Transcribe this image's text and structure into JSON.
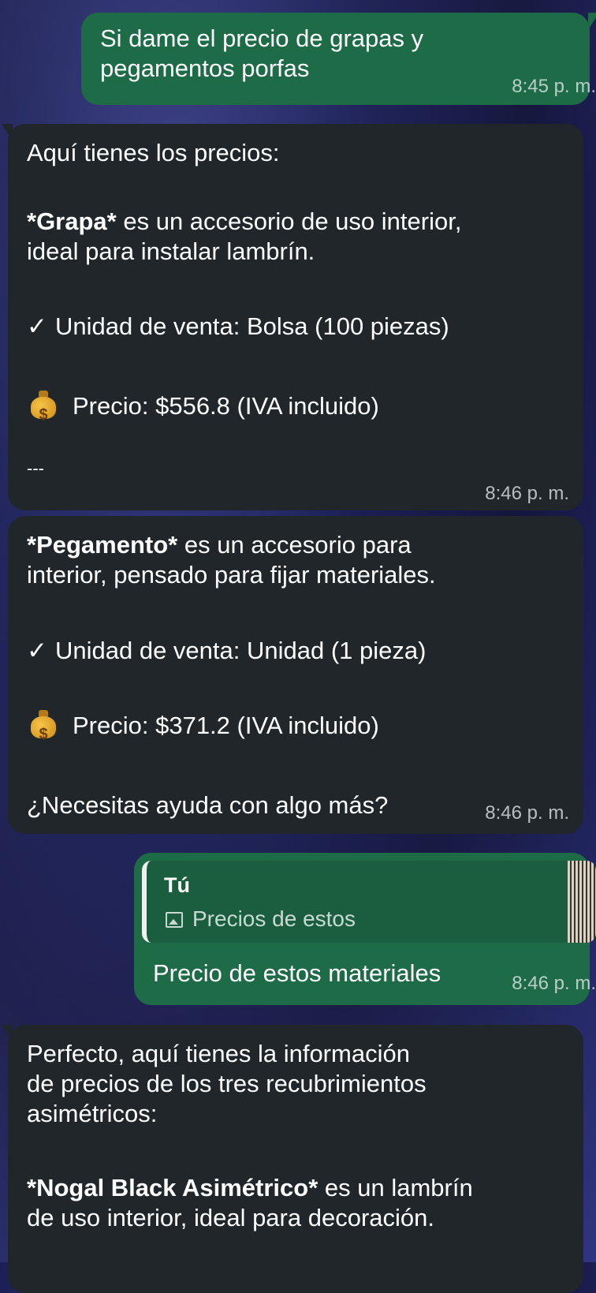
{
  "messages": [
    {
      "text": "Si dame el precio de grapas y\npegamentos porfas",
      "time": "8:45 p. m."
    },
    {
      "intro": "Aquí tienes los precios:",
      "product_name": "*Grapa*",
      "product_desc": " es un accesorio de uso interior,\nideal para instalar lambrín.",
      "check": "✓",
      "unit": "Unidad de venta: Bolsa (100 piezas)",
      "price": "Precio: $556.8 (IVA incluido)",
      "separator": "---",
      "time": "8:46 p. m."
    },
    {
      "product_name": "*Pegamento*",
      "product_desc": " es un accesorio para\ninterior, pensado para fijar materiales.",
      "check": "✓",
      "unit": "Unidad de venta: Unidad (1 pieza)",
      "price": "Precio: $371.2 (IVA incluido)",
      "question": "¿Necesitas ayuda con algo más?",
      "time": "8:46 p. m."
    },
    {
      "quote_author": "Tú",
      "quote_text": "Precios de estos",
      "text": "Precio de estos materiales",
      "time": "8:46 p. m."
    },
    {
      "text": "Perfecto, aquí tienes la información\nde precios de los tres recubrimientos\nasimétricos:",
      "product_name": "*Nogal Black Asimétrico*",
      "product_desc": " es un lambrín\nde uso interior, ideal para decoración."
    }
  ],
  "icons": {
    "money_bag": "money-bag-icon",
    "image": "image-icon"
  },
  "colors": {
    "outgoing_bubble": "#1e6b47",
    "incoming_bubble": "#20262a"
  }
}
